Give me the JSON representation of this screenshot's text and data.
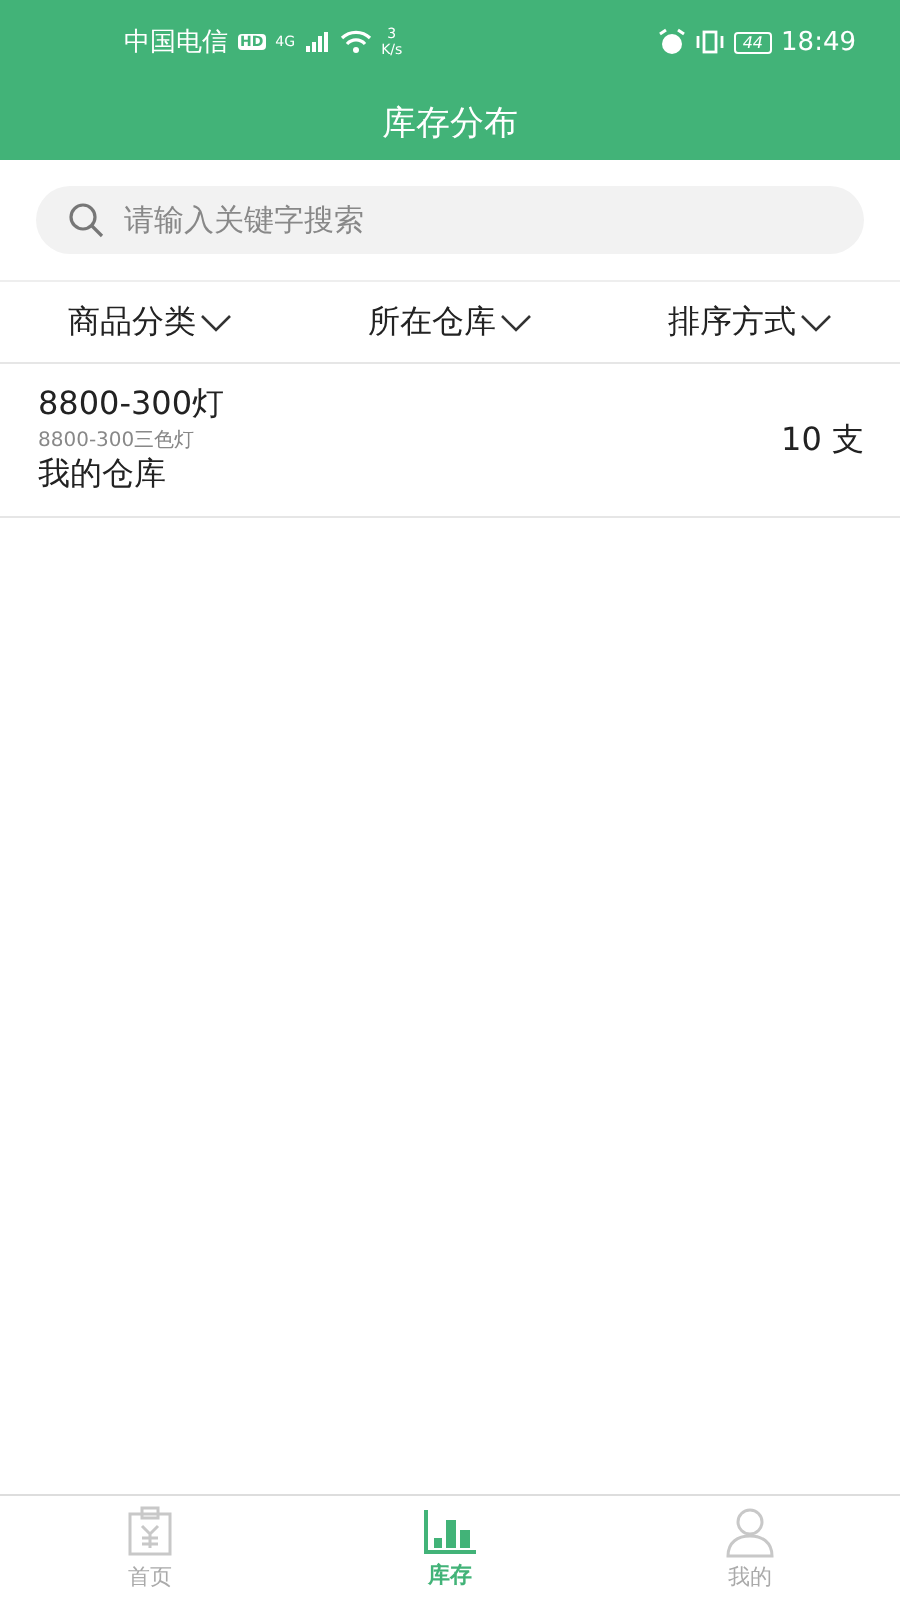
{
  "status_bar": {
    "carrier": "中国电信",
    "hd": "HD",
    "network": "4G",
    "speed_value": "3",
    "speed_unit": "K/s",
    "battery": "44",
    "time": "18:49"
  },
  "title": "库存分布",
  "search": {
    "placeholder": "请输入关键字搜索"
  },
  "filters": [
    {
      "label": "商品分类"
    },
    {
      "label": "所在仓库"
    },
    {
      "label": "排序方式"
    }
  ],
  "items": [
    {
      "name": "8800-300灯",
      "spec": "8800-300三色灯",
      "warehouse": "我的仓库",
      "quantity": "10 支"
    }
  ],
  "tabs": [
    {
      "kind": "home",
      "label": "首页",
      "selected": false
    },
    {
      "kind": "stock",
      "label": "库存",
      "selected": true
    },
    {
      "kind": "profile",
      "label": "我的",
      "selected": false
    }
  ]
}
